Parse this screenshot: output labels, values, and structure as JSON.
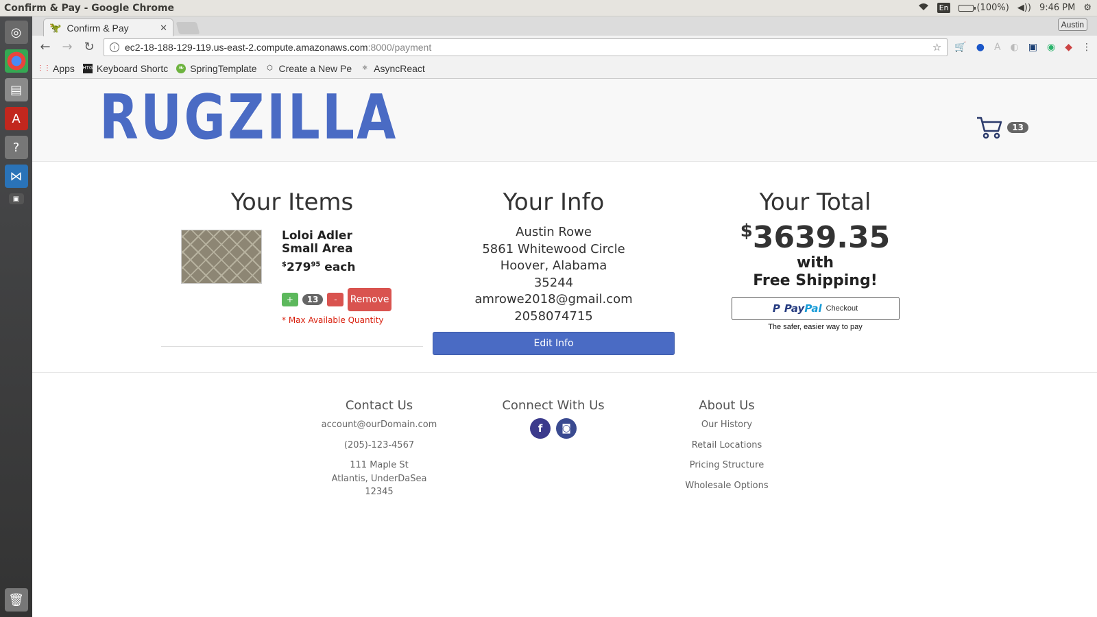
{
  "os": {
    "window_title": "Confirm & Pay - Google Chrome",
    "lang": "En",
    "battery": "(100%)",
    "time": "9:46 PM"
  },
  "browser": {
    "tab_title": "Confirm & Pay",
    "profile": "Austin",
    "url_host": "ec2-18-188-129-119.us-east-2.compute.amazonaws.com",
    "url_rest": ":8000/payment",
    "bookmarks": [
      "Apps",
      "Keyboard Shortc",
      "SpringTemplate",
      "Create a New Pe",
      "AsyncReact"
    ]
  },
  "header": {
    "logo_text": "RUGZILLA",
    "cart_count": "13"
  },
  "items": {
    "title": "Your Items",
    "list": [
      {
        "name": "Loloi Adler Small Area",
        "currency": "$",
        "price_whole": "279",
        "price_cents": "95",
        "price_suffix": " each",
        "plus": "+",
        "qty": "13",
        "minus": "-",
        "remove": "Remove",
        "note": "* Max Available Quantity"
      }
    ]
  },
  "info": {
    "title": "Your Info",
    "name": "Austin Rowe",
    "street": "5861 Whitewood Circle",
    "city_state": "Hoover, Alabama",
    "zip": "35244",
    "email": "amrowe2018@gmail.com",
    "phone": "2058074715",
    "edit_button": "Edit Info"
  },
  "total": {
    "title": "Your Total",
    "currency": "$",
    "amount": "3639.35",
    "line1": "with",
    "line2": "Free Shipping!",
    "paypal_pay": "Pay",
    "paypal_pal": "Pal",
    "paypal_checkout": "Checkout",
    "paypal_tagline": "The safer, easier way to pay"
  },
  "footer": {
    "contact": {
      "title": "Contact Us",
      "email": "account@ourDomain.com",
      "phone": "(205)-123-4567",
      "addr1": "111 Maple St",
      "addr2": "Atlantis, UnderDaSea",
      "addr3": "12345"
    },
    "connect": {
      "title": "Connect With Us",
      "facebook": "f",
      "instagram": "◙"
    },
    "about": {
      "title": "About Us",
      "links": [
        "Our History",
        "Retail Locations",
        "Pricing Structure",
        "Wholesale Options"
      ]
    }
  }
}
